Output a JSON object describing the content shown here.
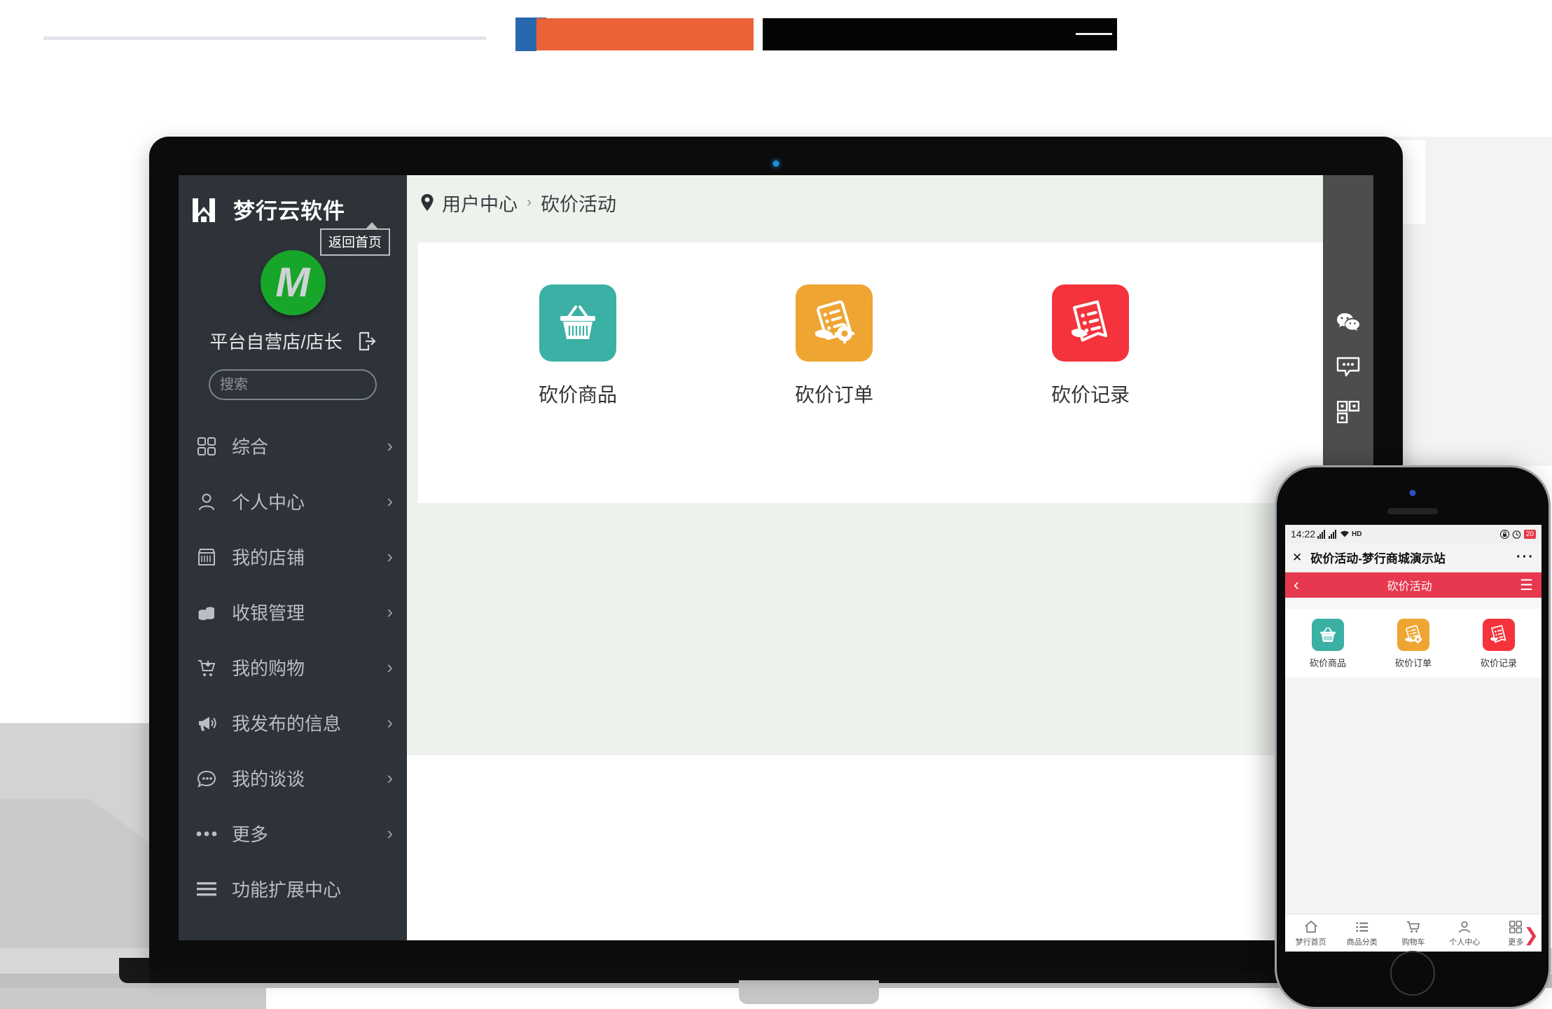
{
  "banner": {
    "note": "redacted-color-blocks"
  },
  "sidebar": {
    "brand": "梦行云软件",
    "home_button": "返回首页",
    "avatar_letter": "M",
    "user_name": "平台自营店/店长",
    "logout_icon": "logout-icon",
    "search": {
      "value": "",
      "placeholder": "搜索"
    },
    "items": [
      {
        "label": "综合",
        "icon": "grid-icon",
        "chevron": "›"
      },
      {
        "label": "个人中心",
        "icon": "user-icon",
        "chevron": "›"
      },
      {
        "label": "我的店铺",
        "icon": "shop-icon",
        "chevron": "›"
      },
      {
        "label": "收银管理",
        "icon": "coins-icon",
        "chevron": "›"
      },
      {
        "label": "我的购物",
        "icon": "cart-icon",
        "chevron": "›"
      },
      {
        "label": "我发布的信息",
        "icon": "megaphone-icon",
        "chevron": "›"
      },
      {
        "label": "我的谈谈",
        "icon": "speech-icon",
        "chevron": "›"
      },
      {
        "label": "更多",
        "icon": "ellipsis-icon",
        "chevron": "›"
      },
      {
        "label": "功能扩展中心",
        "icon": "hamburger-icon",
        "chevron": ""
      }
    ]
  },
  "breadcrumb": {
    "pin_icon": "location-pin-icon",
    "parent": "用户中心",
    "separator": "›",
    "current": "砍价活动"
  },
  "main": {
    "tiles": [
      {
        "label": "砍价商品",
        "icon": "basket-icon",
        "color": "#3bb0a4"
      },
      {
        "label": "砍价订单",
        "icon": "invoice-gear-icon",
        "color": "#efa532"
      },
      {
        "label": "砍价记录",
        "icon": "invoice-icon",
        "color": "#f4333c"
      }
    ]
  },
  "floatbar": {
    "items": [
      {
        "name": "wechat-icon"
      },
      {
        "name": "chat-icon"
      },
      {
        "name": "qrcode-icon"
      }
    ]
  },
  "phone": {
    "status": {
      "time": "14:22",
      "signal": "signal-icon",
      "wifi": "wifi-icon",
      "hd": "HD",
      "lock": "lock-icon",
      "alarm": "alarm-icon",
      "battery": "20"
    },
    "title_bar": {
      "close": "✕",
      "title": "砍价活动-梦行商城演示站",
      "more": "···"
    },
    "nav": {
      "back": "‹",
      "title": "砍价活动",
      "menu": "☰"
    },
    "tiles": [
      {
        "label": "砍价商品",
        "icon": "basket-icon",
        "color": "#3bb0a4"
      },
      {
        "label": "砍价订单",
        "icon": "invoice-gear-icon",
        "color": "#efa532"
      },
      {
        "label": "砍价记录",
        "icon": "invoice-icon",
        "color": "#f4333c"
      }
    ],
    "bottom_nav": [
      {
        "label": "梦行首页",
        "icon": "home-icon"
      },
      {
        "label": "商品分类",
        "icon": "list-icon"
      },
      {
        "label": "购物车",
        "icon": "cart-icon"
      },
      {
        "label": "个人中心",
        "icon": "user-icon"
      },
      {
        "label": "更多",
        "icon": "grid-icon"
      }
    ],
    "arrow": "❯"
  },
  "colors": {
    "sidebar_bg": "#2d3338",
    "content_bg": "#eef2ec",
    "accent_red": "#e6384f",
    "avatar_green": "#17a52a",
    "teal": "#3bb0a4",
    "orange": "#efa532",
    "red": "#f4333c"
  }
}
